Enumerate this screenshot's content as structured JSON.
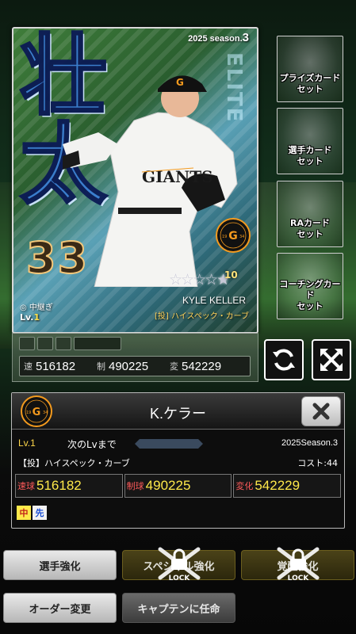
{
  "card": {
    "season_label": "2025 season.",
    "season_number": "3",
    "kanji": "壮\n太",
    "vertical_text": "ELITE",
    "number": "33",
    "star_level": "10",
    "player_name_en": "KYLE KELLER",
    "skill_card": "[投] ハイスペック・カーブ",
    "role": "◎ 中継ぎ",
    "lv_label": "Lv.",
    "lv_value": "1",
    "emblem_text": "G",
    "emblem_left": "19",
    "emblem_right": "34",
    "emblem_bottom": "TOKYO"
  },
  "stat_plate": {
    "speed_label": "速",
    "speed_value": "516182",
    "control_label": "制",
    "control_value": "490225",
    "break_label": "変",
    "break_value": "542229"
  },
  "side_buttons": [
    {
      "label": "プライズカード\nセット"
    },
    {
      "label": "選手カード\nセット"
    },
    {
      "label": "RAカード\nセット"
    },
    {
      "label": "コーチングカード\nセット"
    }
  ],
  "info": {
    "name": "K.ケラー",
    "lv_label": "Lv.",
    "lv_value": "1",
    "next_lv_label": "次のLvまで",
    "season": "2025Season.3",
    "skill": "【投】ハイスペック・カーブ",
    "cost": "コスト:44",
    "stats": [
      {
        "label": "速球",
        "value": "516182"
      },
      {
        "label": "制球",
        "value": "490225"
      },
      {
        "label": "変化",
        "value": "542229"
      }
    ],
    "positions": [
      "中",
      "先"
    ]
  },
  "bottom_buttons": {
    "enhance": "選手強化",
    "special": "スペシャル強化",
    "awaken": "覚醒強化",
    "order": "オーダー変更",
    "captain": "キャプテンに任命",
    "lock_label": "LOCK"
  },
  "colors": {
    "accent_yellow": "#ffe94a",
    "stat_label_red": "#ff5a5a",
    "giants_orange": "#f39a1e"
  }
}
